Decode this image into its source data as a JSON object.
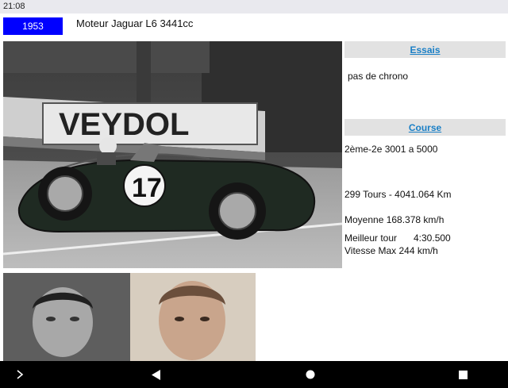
{
  "status_bar": {
    "time": "21:08"
  },
  "header": {
    "year": "1953",
    "engine": "Moteur Jaguar L6 3441cc"
  },
  "essais": {
    "title": "Essais",
    "text": "pas de chrono"
  },
  "course": {
    "title": "Course",
    "classement": "2ème-2e 3001 a 5000",
    "tours": "299 Tours - 4041.064 Km",
    "moyenne": "Moyenne 168.378 km/h",
    "meilleur_tour": "Meilleur tour",
    "meilleur_tour_temps": "4:30.500",
    "vitesse_max": "Vitesse Max 244 km/h"
  },
  "race_photo": {
    "banner_text": "VEYDOL",
    "car_number": "17"
  },
  "nav_bar": {
    "icons": [
      "chevron-right-icon",
      "back-icon",
      "home-icon",
      "recents-icon"
    ]
  }
}
